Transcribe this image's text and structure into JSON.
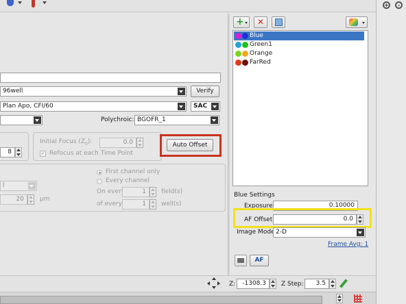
{
  "acquisition": {
    "plate_value": "96well",
    "verify_label": "Verify",
    "objective_value": "Plan Apo, CFI/60",
    "objective_corr": "SAC",
    "polychroic_label": "Polychroic:",
    "polychroic_value": "BGOFR_1",
    "count_value": "8",
    "initial_focus_prefix": "Initial Focus (Z",
    "initial_focus_sub": "0",
    "initial_focus_suffix": "):",
    "initial_focus_value": "0.0",
    "refocus_label": "Refocus at each Time Point",
    "auto_offset_label": "Auto Offset",
    "first_channel_label": "First channel only",
    "every_channel_label": "Every channel",
    "on_every_label": "On every",
    "on_every_value": "1",
    "fields_label": "field(s)",
    "of_every_label": "of every",
    "of_every_value": "1",
    "wells_label": "well(s)",
    "distance_value": "20",
    "distance_unit": "µm",
    "mode_value": "l"
  },
  "channels": {
    "items": [
      {
        "label": "Blue",
        "c1": "#d81ed8",
        "c2": "#1f2fd6",
        "selected": true
      },
      {
        "label": "Green1",
        "c1": "#21a3d6",
        "c2": "#1bc41b",
        "selected": false
      },
      {
        "label": "Orange",
        "c1": "#7ed321",
        "c2": "#f5a623",
        "selected": false
      },
      {
        "label": "FarRed",
        "c1": "#e03a1b",
        "c2": "#6e1408",
        "selected": false
      }
    ]
  },
  "settings": {
    "title": "Blue Settings",
    "exposure_label": "Exposure:",
    "exposure_value": "0.10000",
    "af_offset_label": "AF Offset:",
    "af_offset_value": "0.0",
    "image_mode_label": "Image Mode:",
    "image_mode_value": "2-D",
    "frame_avg_label": "Frame Avg: 1",
    "af_button_label": "AF"
  },
  "status": {
    "z_label": "Z:",
    "z_value": "-1308.3",
    "z_step_label": "Z Step:",
    "z_step_value": "3.5"
  },
  "highlights": {
    "red": "#c8321e",
    "yellow": "#f2e01a",
    "selection": "#3a76c4"
  }
}
